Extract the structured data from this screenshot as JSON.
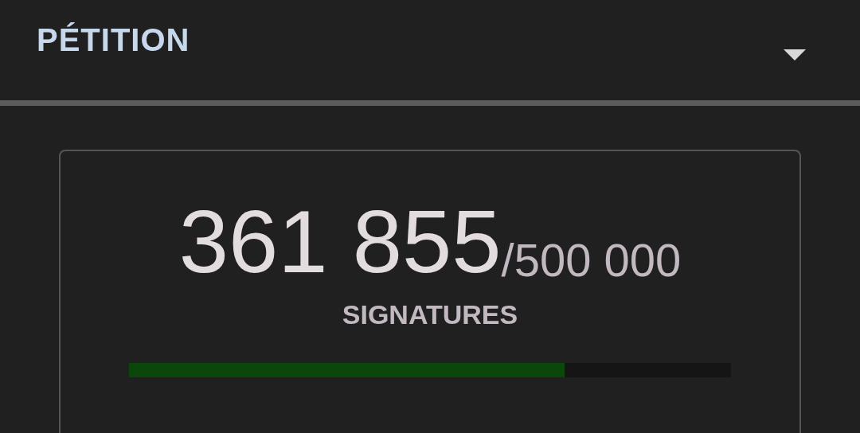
{
  "header": {
    "title": "PÉTITION",
    "expanded": true
  },
  "petition": {
    "count": "361 855",
    "goal": "/500 000",
    "label": "SIGNATURES",
    "level": 0.7237
  }
}
